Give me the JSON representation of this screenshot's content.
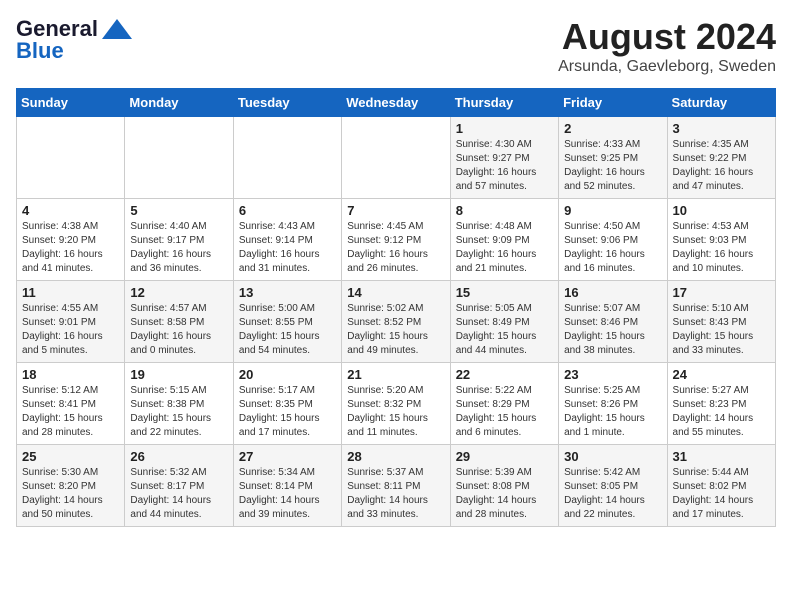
{
  "header": {
    "logo_line1": "General",
    "logo_line2": "Blue",
    "main_title": "August 2024",
    "sub_title": "Arsunda, Gaevleborg, Sweden"
  },
  "days_of_week": [
    "Sunday",
    "Monday",
    "Tuesday",
    "Wednesday",
    "Thursday",
    "Friday",
    "Saturday"
  ],
  "weeks": [
    [
      {
        "day": "",
        "content": ""
      },
      {
        "day": "",
        "content": ""
      },
      {
        "day": "",
        "content": ""
      },
      {
        "day": "",
        "content": ""
      },
      {
        "day": "1",
        "content": "Sunrise: 4:30 AM\nSunset: 9:27 PM\nDaylight: 16 hours\nand 57 minutes."
      },
      {
        "day": "2",
        "content": "Sunrise: 4:33 AM\nSunset: 9:25 PM\nDaylight: 16 hours\nand 52 minutes."
      },
      {
        "day": "3",
        "content": "Sunrise: 4:35 AM\nSunset: 9:22 PM\nDaylight: 16 hours\nand 47 minutes."
      }
    ],
    [
      {
        "day": "4",
        "content": "Sunrise: 4:38 AM\nSunset: 9:20 PM\nDaylight: 16 hours\nand 41 minutes."
      },
      {
        "day": "5",
        "content": "Sunrise: 4:40 AM\nSunset: 9:17 PM\nDaylight: 16 hours\nand 36 minutes."
      },
      {
        "day": "6",
        "content": "Sunrise: 4:43 AM\nSunset: 9:14 PM\nDaylight: 16 hours\nand 31 minutes."
      },
      {
        "day": "7",
        "content": "Sunrise: 4:45 AM\nSunset: 9:12 PM\nDaylight: 16 hours\nand 26 minutes."
      },
      {
        "day": "8",
        "content": "Sunrise: 4:48 AM\nSunset: 9:09 PM\nDaylight: 16 hours\nand 21 minutes."
      },
      {
        "day": "9",
        "content": "Sunrise: 4:50 AM\nSunset: 9:06 PM\nDaylight: 16 hours\nand 16 minutes."
      },
      {
        "day": "10",
        "content": "Sunrise: 4:53 AM\nSunset: 9:03 PM\nDaylight: 16 hours\nand 10 minutes."
      }
    ],
    [
      {
        "day": "11",
        "content": "Sunrise: 4:55 AM\nSunset: 9:01 PM\nDaylight: 16 hours\nand 5 minutes."
      },
      {
        "day": "12",
        "content": "Sunrise: 4:57 AM\nSunset: 8:58 PM\nDaylight: 16 hours\nand 0 minutes."
      },
      {
        "day": "13",
        "content": "Sunrise: 5:00 AM\nSunset: 8:55 PM\nDaylight: 15 hours\nand 54 minutes."
      },
      {
        "day": "14",
        "content": "Sunrise: 5:02 AM\nSunset: 8:52 PM\nDaylight: 15 hours\nand 49 minutes."
      },
      {
        "day": "15",
        "content": "Sunrise: 5:05 AM\nSunset: 8:49 PM\nDaylight: 15 hours\nand 44 minutes."
      },
      {
        "day": "16",
        "content": "Sunrise: 5:07 AM\nSunset: 8:46 PM\nDaylight: 15 hours\nand 38 minutes."
      },
      {
        "day": "17",
        "content": "Sunrise: 5:10 AM\nSunset: 8:43 PM\nDaylight: 15 hours\nand 33 minutes."
      }
    ],
    [
      {
        "day": "18",
        "content": "Sunrise: 5:12 AM\nSunset: 8:41 PM\nDaylight: 15 hours\nand 28 minutes."
      },
      {
        "day": "19",
        "content": "Sunrise: 5:15 AM\nSunset: 8:38 PM\nDaylight: 15 hours\nand 22 minutes."
      },
      {
        "day": "20",
        "content": "Sunrise: 5:17 AM\nSunset: 8:35 PM\nDaylight: 15 hours\nand 17 minutes."
      },
      {
        "day": "21",
        "content": "Sunrise: 5:20 AM\nSunset: 8:32 PM\nDaylight: 15 hours\nand 11 minutes."
      },
      {
        "day": "22",
        "content": "Sunrise: 5:22 AM\nSunset: 8:29 PM\nDaylight: 15 hours\nand 6 minutes."
      },
      {
        "day": "23",
        "content": "Sunrise: 5:25 AM\nSunset: 8:26 PM\nDaylight: 15 hours\nand 1 minute."
      },
      {
        "day": "24",
        "content": "Sunrise: 5:27 AM\nSunset: 8:23 PM\nDaylight: 14 hours\nand 55 minutes."
      }
    ],
    [
      {
        "day": "25",
        "content": "Sunrise: 5:30 AM\nSunset: 8:20 PM\nDaylight: 14 hours\nand 50 minutes."
      },
      {
        "day": "26",
        "content": "Sunrise: 5:32 AM\nSunset: 8:17 PM\nDaylight: 14 hours\nand 44 minutes."
      },
      {
        "day": "27",
        "content": "Sunrise: 5:34 AM\nSunset: 8:14 PM\nDaylight: 14 hours\nand 39 minutes."
      },
      {
        "day": "28",
        "content": "Sunrise: 5:37 AM\nSunset: 8:11 PM\nDaylight: 14 hours\nand 33 minutes."
      },
      {
        "day": "29",
        "content": "Sunrise: 5:39 AM\nSunset: 8:08 PM\nDaylight: 14 hours\nand 28 minutes."
      },
      {
        "day": "30",
        "content": "Sunrise: 5:42 AM\nSunset: 8:05 PM\nDaylight: 14 hours\nand 22 minutes."
      },
      {
        "day": "31",
        "content": "Sunrise: 5:44 AM\nSunset: 8:02 PM\nDaylight: 14 hours\nand 17 minutes."
      }
    ]
  ]
}
